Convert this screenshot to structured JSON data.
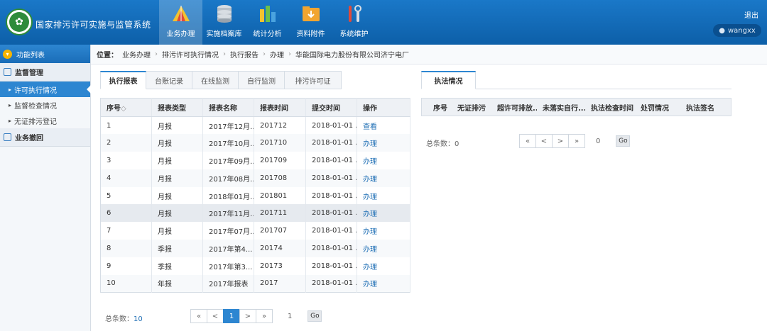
{
  "header": {
    "app_title": "国家排污许可实施与监管系统",
    "nav": [
      {
        "label": "业务办理",
        "active": true,
        "icon": "tent-icon"
      },
      {
        "label": "实施档案库",
        "active": false,
        "icon": "database-icon"
      },
      {
        "label": "统计分析",
        "active": false,
        "icon": "bar-chart-icon"
      },
      {
        "label": "资料附件",
        "active": false,
        "icon": "folder-download-icon"
      },
      {
        "label": "系统维护",
        "active": false,
        "icon": "tools-icon"
      }
    ],
    "logout": "退出",
    "user": "wangxx"
  },
  "sidebar": {
    "title": "功能列表",
    "groups": [
      {
        "label": "监督管理",
        "items": [
          "许可执行情况",
          "监督检查情况",
          "无证排污登记"
        ]
      },
      {
        "label": "业务撤回",
        "items": []
      }
    ],
    "active_item": "许可执行情况"
  },
  "breadcrumb": {
    "prefix": "位置：",
    "items": [
      "业务办理",
      "排污许可执行情况",
      "执行报告",
      "办理",
      "华能国际电力股份有限公司济宁电厂"
    ]
  },
  "left_tabs": [
    "执行报表",
    "台账记录",
    "在线监测",
    "自行监测",
    "排污许可证"
  ],
  "left_table": {
    "headers": [
      "序号",
      "报表类型",
      "报表名称",
      "报表时间",
      "提交时间",
      "操作"
    ],
    "sort_mark": "◇",
    "rows": [
      [
        "1",
        "月报",
        "2017年12月...",
        "201712",
        "2018-01-01 ...",
        "查看"
      ],
      [
        "2",
        "月报",
        "2017年10月...",
        "201710",
        "2018-01-01 ...",
        "办理"
      ],
      [
        "3",
        "月报",
        "2017年09月...",
        "201709",
        "2018-01-01 ...",
        "办理"
      ],
      [
        "4",
        "月报",
        "2017年08月...",
        "201708",
        "2018-01-01 ...",
        "办理"
      ],
      [
        "5",
        "月报",
        "2018年01月...",
        "201801",
        "2018-01-01 ...",
        "办理"
      ],
      [
        "6",
        "月报",
        "2017年11月...",
        "201711",
        "2018-01-01 ...",
        "办理"
      ],
      [
        "7",
        "月报",
        "2017年07月...",
        "201707",
        "2018-01-01 ...",
        "办理"
      ],
      [
        "8",
        "季报",
        "2017年第4...",
        "20174",
        "2018-01-01 ...",
        "办理"
      ],
      [
        "9",
        "季报",
        "2017年第3...",
        "20173",
        "2018-01-01 ...",
        "办理"
      ],
      [
        "10",
        "年报",
        "2017年报表",
        "2017",
        "2018-01-01 ...",
        "办理"
      ]
    ],
    "highlighted_row": 6
  },
  "left_pager": {
    "total_label": "总条数：",
    "total": "10",
    "buttons": [
      "«",
      "<",
      "1",
      ">",
      "»"
    ],
    "current": "1",
    "page_input": "1",
    "go": "Go"
  },
  "right_tab": "执法情况",
  "right_table": {
    "headers": [
      "序号",
      "无证排污",
      "超许可排放...",
      "未落实自行...",
      "执法检查时间",
      "处罚情况",
      "执法签名"
    ],
    "sort_mark": "◇"
  },
  "right_pager": {
    "total_label": "总条数：",
    "total": "0",
    "buttons": [
      "«",
      "<",
      ">",
      "»"
    ],
    "page_input": "0",
    "go": "Go"
  },
  "colors": {
    "header_blue": "#1a78c8",
    "active_blue": "#2d86d1",
    "link": "#1f6fb5",
    "logo_green": "#2e8b3a"
  }
}
